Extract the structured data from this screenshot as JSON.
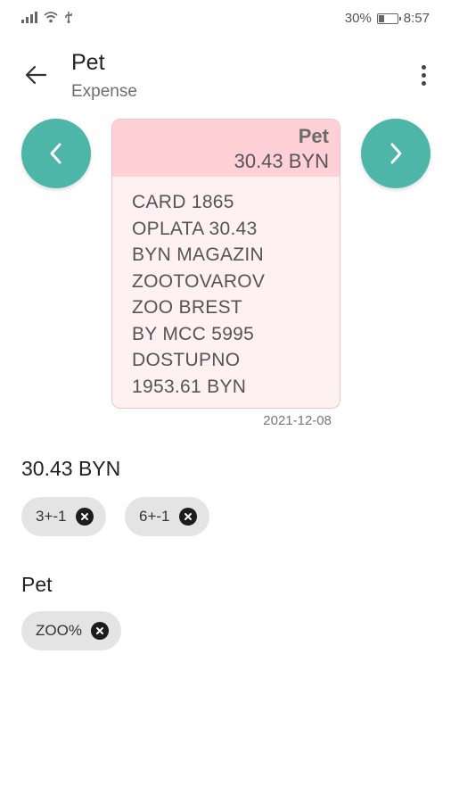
{
  "status_bar": {
    "battery_percent": "30%",
    "time": "8:57",
    "battery_level": 0.3
  },
  "app_bar": {
    "title": "Pet",
    "subtitle": "Expense"
  },
  "message": {
    "category": "Pet",
    "amount": "30.43 BYN",
    "lines": [
      "CARD 1865",
      "OPLATA 30.43",
      "BYN MAGAZIN",
      "ZOOTOVAROV",
      "ZOO BREST",
      "BY MCC 5995",
      "DOSTUPNO",
      "1953.61 BYN"
    ],
    "date": "2021-12-08"
  },
  "amount_section": {
    "title": "30.43 BYN",
    "chips": [
      "3+-1",
      "6+-1"
    ]
  },
  "category_section": {
    "title": "Pet",
    "chips": [
      "ZOO%"
    ]
  },
  "icons": {
    "back": "arrow-left-icon",
    "more": "more-vert-icon",
    "prev": "chevron-left-icon",
    "next": "chevron-right-icon",
    "chip_remove": "close-circle-icon"
  },
  "colors": {
    "accent": "#4db6a8",
    "card_header": "#ffd0d6",
    "card_body": "#fff0f2",
    "chip": "#e4e4e4"
  }
}
